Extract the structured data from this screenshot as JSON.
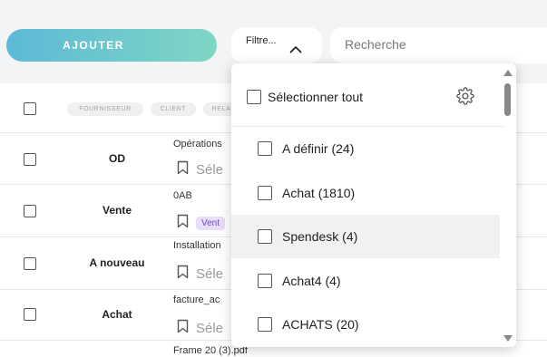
{
  "toolbar": {
    "add_label": "AJOUTER",
    "filter_label": "Filtre...",
    "search_placeholder": "Recherche"
  },
  "table": {
    "header_chips": [
      "FOURNISSEUR",
      "CLIENT",
      "RELA"
    ],
    "rows": [
      {
        "journal": "OD",
        "doc": "Opérations",
        "tag": "Séle",
        "pill": ""
      },
      {
        "journal": "Vente",
        "doc": "0AB",
        "tag": "",
        "pill": "Vent"
      },
      {
        "journal": "A nouveau",
        "doc": "Installation",
        "tag": "Séle",
        "pill": ""
      },
      {
        "journal": "Achat",
        "doc": "facture_ac",
        "tag": "Séle",
        "pill": ""
      }
    ],
    "last_doc": "Frame 20 (3).pdf"
  },
  "dropdown": {
    "select_all_label": "Sélectionner tout",
    "options": [
      {
        "label": "A définir (24)",
        "highlighted": false
      },
      {
        "label": "Achat (1810)",
        "highlighted": false
      },
      {
        "label": "Spendesk (4)",
        "highlighted": true
      },
      {
        "label": "Achat4 (4)",
        "highlighted": false
      },
      {
        "label": "ACHATS (20)",
        "highlighted": false
      }
    ]
  },
  "colors": {
    "add_button_start": "#5db9d6",
    "add_button_end": "#7fd6c4",
    "pill_bg": "#e8ddfb",
    "pill_text": "#6f4fb3"
  },
  "icons": [
    "chevron-up-icon",
    "gear-icon",
    "bookmark-icon",
    "scroll-up-arrow-icon",
    "scroll-down-arrow-icon"
  ]
}
